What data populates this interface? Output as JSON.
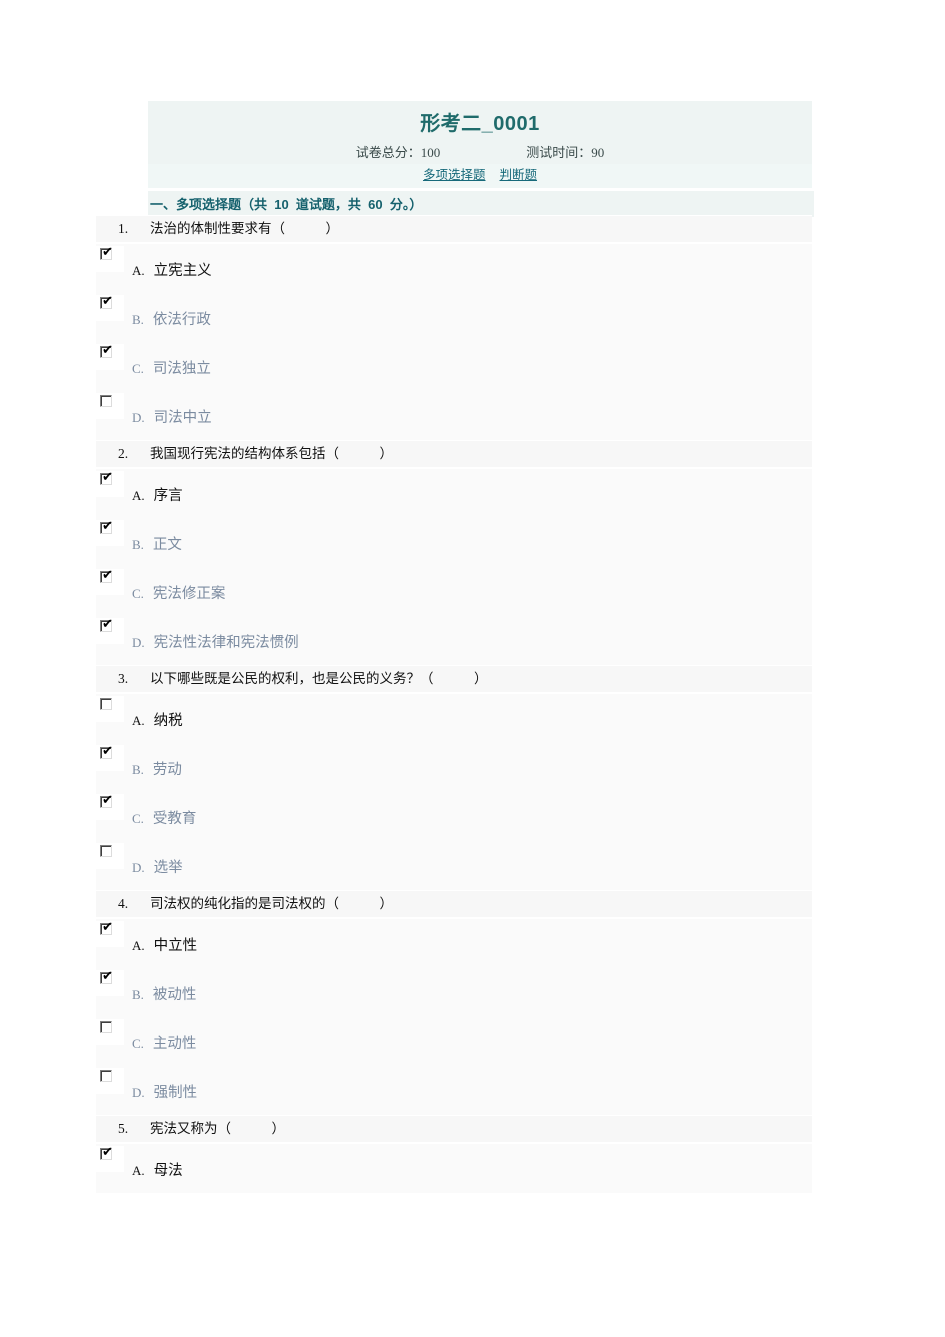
{
  "header": {
    "title": "形考二_0001",
    "total_score_label": "试卷总分：",
    "total_score_value": "100",
    "time_label": "测试时间：",
    "time_value": "90",
    "links": [
      {
        "label": "多项选择题",
        "name": "link-multiple-choice"
      },
      {
        "label": "判断题",
        "name": "link-true-false"
      }
    ]
  },
  "section": {
    "heading": "一、多项选择题（共  10  道试题，共  60  分。）"
  },
  "questions": [
    {
      "number": "1.",
      "text": "法治的体制性要求有（            ）",
      "options": [
        {
          "letter": "A.",
          "text": "立宪主义",
          "checked": true,
          "muted": false
        },
        {
          "letter": "B.",
          "text": "依法行政",
          "checked": true,
          "muted": true
        },
        {
          "letter": "C.",
          "text": "司法独立",
          "checked": true,
          "muted": true
        },
        {
          "letter": "D.",
          "text": "司法中立",
          "checked": false,
          "muted": true
        }
      ]
    },
    {
      "number": "2.",
      "text": "我国现行宪法的结构体系包括（            ）",
      "options": [
        {
          "letter": "A.",
          "text": "序言",
          "checked": true,
          "muted": false
        },
        {
          "letter": "B.",
          "text": "正文",
          "checked": true,
          "muted": true
        },
        {
          "letter": "C.",
          "text": "宪法修正案",
          "checked": true,
          "muted": true
        },
        {
          "letter": "D.",
          "text": "宪法性法律和宪法惯例",
          "checked": true,
          "muted": true
        }
      ]
    },
    {
      "number": "3.",
      "text": "以下哪些既是公民的权利，也是公民的义务？（            ）",
      "options": [
        {
          "letter": "A.",
          "text": "纳税",
          "checked": false,
          "muted": false
        },
        {
          "letter": "B.",
          "text": "劳动",
          "checked": true,
          "muted": true
        },
        {
          "letter": "C.",
          "text": "受教育",
          "checked": true,
          "muted": true
        },
        {
          "letter": "D.",
          "text": "选举",
          "checked": false,
          "muted": true
        }
      ]
    },
    {
      "number": "4.",
      "text": "司法权的纯化指的是司法权的（            ）",
      "options": [
        {
          "letter": "A.",
          "text": "中立性",
          "checked": true,
          "muted": false
        },
        {
          "letter": "B.",
          "text": "被动性",
          "checked": true,
          "muted": true
        },
        {
          "letter": "C.",
          "text": "主动性",
          "checked": false,
          "muted": true
        },
        {
          "letter": "D.",
          "text": "强制性",
          "checked": false,
          "muted": true
        }
      ]
    },
    {
      "number": "5.",
      "text": "宪法又称为（            ）",
      "options": [
        {
          "letter": "A.",
          "text": "母法",
          "checked": true,
          "muted": false
        }
      ]
    }
  ],
  "icons": {
    "checkmark": "✔"
  },
  "colors": {
    "header_bg": "#eef4f3",
    "title": "#1f6b6b",
    "link": "#16697a",
    "section_heading": "#15616d",
    "question_bg": "#f7f7f7",
    "option_bg": "#fafafa",
    "option_muted_text": "#7b8ba0"
  }
}
